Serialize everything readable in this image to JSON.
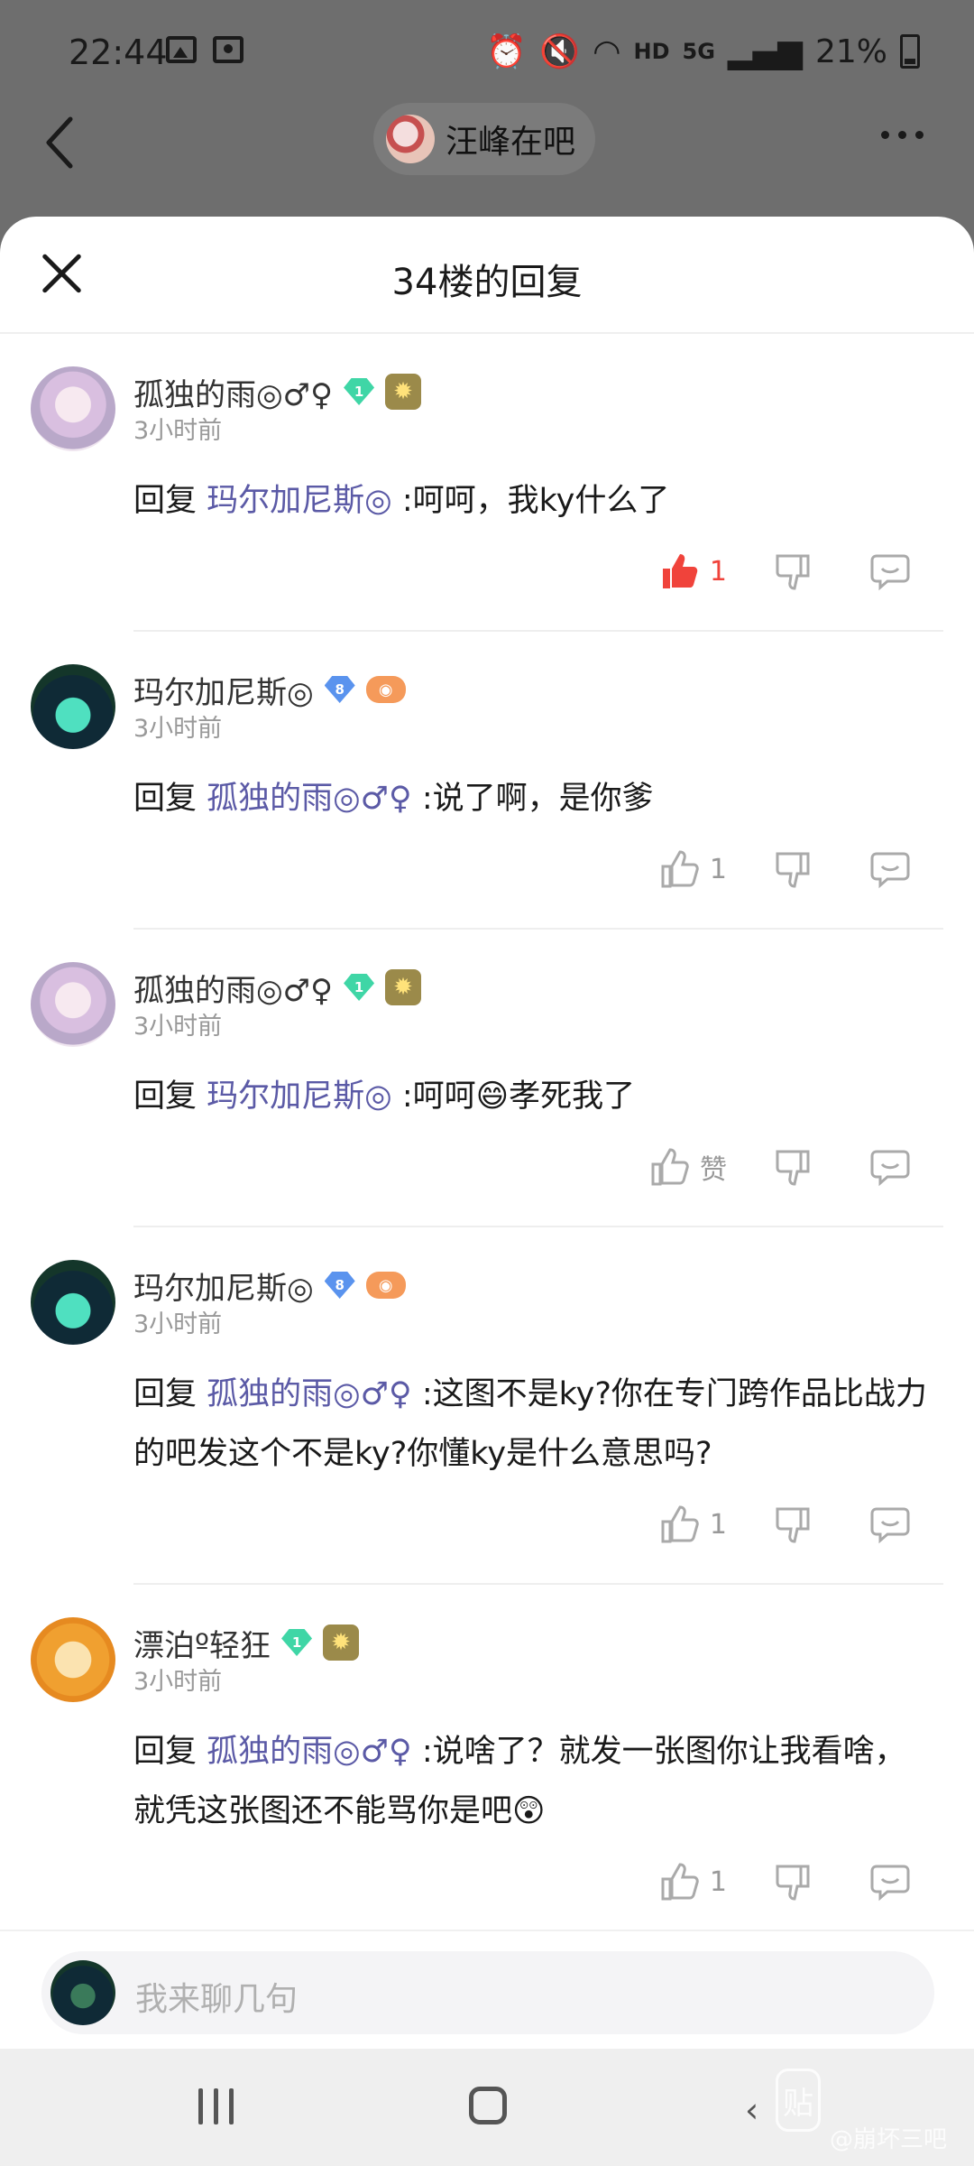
{
  "status_bar": {
    "time": "22:44",
    "network": "HD",
    "network_gen": "5G",
    "battery": "21%"
  },
  "nav": {
    "forum_name": "汪峰在吧"
  },
  "sheet": {
    "title": "34楼的回复"
  },
  "comments": [
    {
      "author": "孤独的雨◎♂♀",
      "level": "1",
      "level_color": "#3fd6a6",
      "time": "3小时前",
      "reply_prefix": "回复 ",
      "mention": "玛尔加尼斯◎",
      "text": " :呵呵，我ky什么了",
      "likes": "1",
      "liked": true
    },
    {
      "author": "玛尔加尼斯◎",
      "level": "8",
      "level_color": "#5a93ee",
      "time": "3小时前",
      "reply_prefix": "回复 ",
      "mention": "孤独的雨◎♂♀",
      "text": " :说了啊，是你爹",
      "likes": "1",
      "liked": false
    },
    {
      "author": "孤独的雨◎♂♀",
      "level": "1",
      "level_color": "#3fd6a6",
      "time": "3小时前",
      "reply_prefix": "回复 ",
      "mention": "玛尔加尼斯◎",
      "text": " :呵呵😄孝死我了",
      "likes": "赞",
      "liked": false
    },
    {
      "author": "玛尔加尼斯◎",
      "level": "8",
      "level_color": "#5a93ee",
      "time": "3小时前",
      "reply_prefix": "回复 ",
      "mention": "孤独的雨◎♂♀",
      "text": " :这图不是ky?你在专门跨作品比战力的吧发这个不是ky?你懂ky是什么意思吗?",
      "likes": "1",
      "liked": false
    },
    {
      "author": "漂泊º轻狂",
      "level": "1",
      "level_color": "#3fd6a6",
      "time": "3小时前",
      "reply_prefix": "回复 ",
      "mention": "孤独的雨◎♂♀",
      "text": " :说啥了？就发一张图你让我看啥，就凭这张图还不能骂你是吧😲",
      "likes": "1",
      "liked": false
    }
  ],
  "input": {
    "placeholder": "我来聊几句"
  },
  "watermark": {
    "logo": "贴",
    "text": "@崩坏三吧"
  }
}
